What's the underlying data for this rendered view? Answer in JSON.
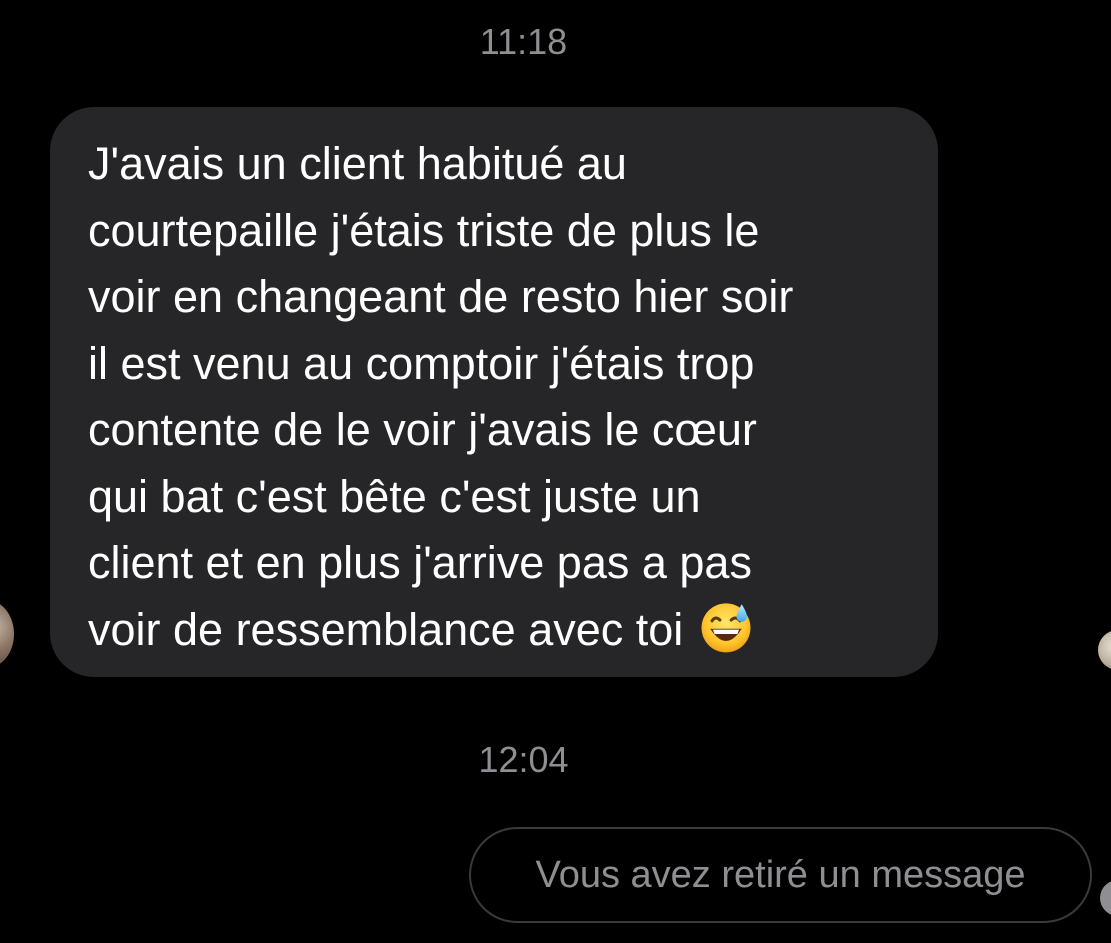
{
  "conversation": {
    "timestamps": [
      "11:18",
      "12:04"
    ],
    "incoming_message": {
      "lines": [
        "J'avais un client habitué au",
        "courtepaille j'étais triste de plus le",
        "voir en changeant de resto hier soir",
        "il est venu au comptoir j'étais trop",
        "contente de le voir j'avais le cœur",
        "qui bat c'est bête c'est juste un",
        "client et en plus j'arrive pas a pas",
        "voir de ressemblance avec toi"
      ],
      "emoji": "grinning-face-with-sweat"
    },
    "removed_message": {
      "text": "Vous avez retiré un message"
    }
  },
  "colors": {
    "background": "#000000",
    "incoming_bubble": "#262628",
    "secondary_text": "#8e8e93",
    "removed_border": "#3a3a3c"
  }
}
